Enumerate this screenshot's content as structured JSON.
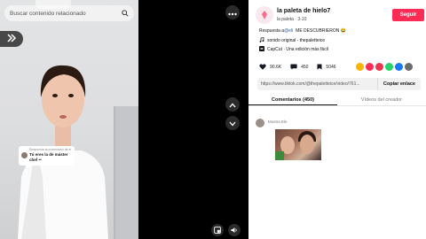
{
  "video": {
    "search_placeholder": "Buscar contenido relacionado",
    "reply_small": "Respuesta al comentario de el",
    "reply_text": "Tú eres la de máster chef ••"
  },
  "author": {
    "name": "la paleta de hielo7",
    "sub": "la paleta · 3-10",
    "follow": "Seguir"
  },
  "description": {
    "prefix": "Respuesta a",
    "mention": "@eli",
    "text": "ME DESCUBRIERON 😂",
    "sound": "sonido original - thepaletteice",
    "capcut": "CapCut · Una edición más fácil"
  },
  "stats": {
    "likes": "90.6K",
    "comments": "450",
    "saves": "5046"
  },
  "share_colors": [
    "#fbb400",
    "#fe2c55",
    "#e8374f",
    "#25d366",
    "#1877f2",
    "#6b6b6b"
  ],
  "link": {
    "url": "https://www.tiktok.com/@thepaletteice/video/761...",
    "copy": "Copiar enlace"
  },
  "tabs": {
    "comments": "Comentarios (450)",
    "creator": "Vídeos del creador"
  },
  "comment": {
    "user": "Mostra Ele"
  },
  "icons": [
    "search-icon",
    "chevron-double-right-icon",
    "more-horizontal-icon",
    "chevron-up-icon",
    "chevron-down-icon",
    "pip-icon",
    "volume-icon",
    "heart-icon",
    "comment-icon",
    "bookmark-icon",
    "music-note-icon",
    "capcut-icon"
  ]
}
